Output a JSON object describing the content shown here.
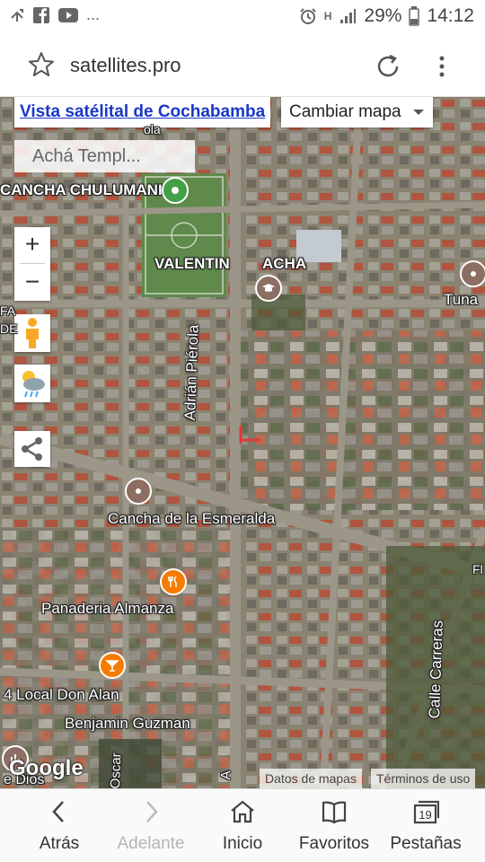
{
  "status_bar": {
    "battery": "29%",
    "time": "14:12",
    "more": "...",
    "network_badge": "H",
    "icons": [
      "usb-icon",
      "facebook-icon",
      "youtube-icon",
      "alarm-icon",
      "signal-icon",
      "battery-icon"
    ]
  },
  "browser": {
    "url": "satellites.pro",
    "icons": [
      "star-icon",
      "reload-icon",
      "overflow-menu-icon"
    ]
  },
  "map": {
    "title_link": "Vista satélital de Cochabamba",
    "change_map_label": "Cambiar mapa",
    "search_value": "Achá Templ...",
    "zoom_in": "+",
    "zoom_out": "−",
    "labels": {
      "cancha_chulumani": "CANCHA CHULUMANI",
      "valentin": "VALENTIN",
      "acha": "ACHA",
      "tuna": "Tuna",
      "adrian_pierola": "Adrián Piérola",
      "cancha_esmeralda": "Cancha de la Esmeralda",
      "panaderia": "Panaderia Almanza",
      "local_don_alan": "4 Local Don Alan",
      "benjamin_guzman": "Benjamin Guzman",
      "calle_carreras": "Calle Carreras",
      "de_dios": "e Dios",
      "oscar": "Oscar",
      "fi": "Fl",
      "fa": "FA",
      "de": "DE",
      "cut_a": "A",
      "la": "ola"
    },
    "google_logo": "Google",
    "map_data": "Datos de mapas",
    "terms": "Términos de uso"
  },
  "bottom_nav": [
    {
      "label": "Atrás",
      "icon": "back-arrow-icon",
      "enabled": true
    },
    {
      "label": "Adelante",
      "icon": "forward-arrow-icon",
      "enabled": false
    },
    {
      "label": "Inicio",
      "icon": "home-icon",
      "enabled": true
    },
    {
      "label": "Favoritos",
      "icon": "bookmarks-icon",
      "enabled": true
    },
    {
      "label": "Pestañas",
      "icon": "tabs-icon",
      "enabled": true,
      "badge": "19"
    }
  ],
  "colors": {
    "link_blue": "#1a37c9",
    "green_pin": "#43a047",
    "brown_pin": "#8d6e63",
    "orange_pin": "#f57c00"
  }
}
